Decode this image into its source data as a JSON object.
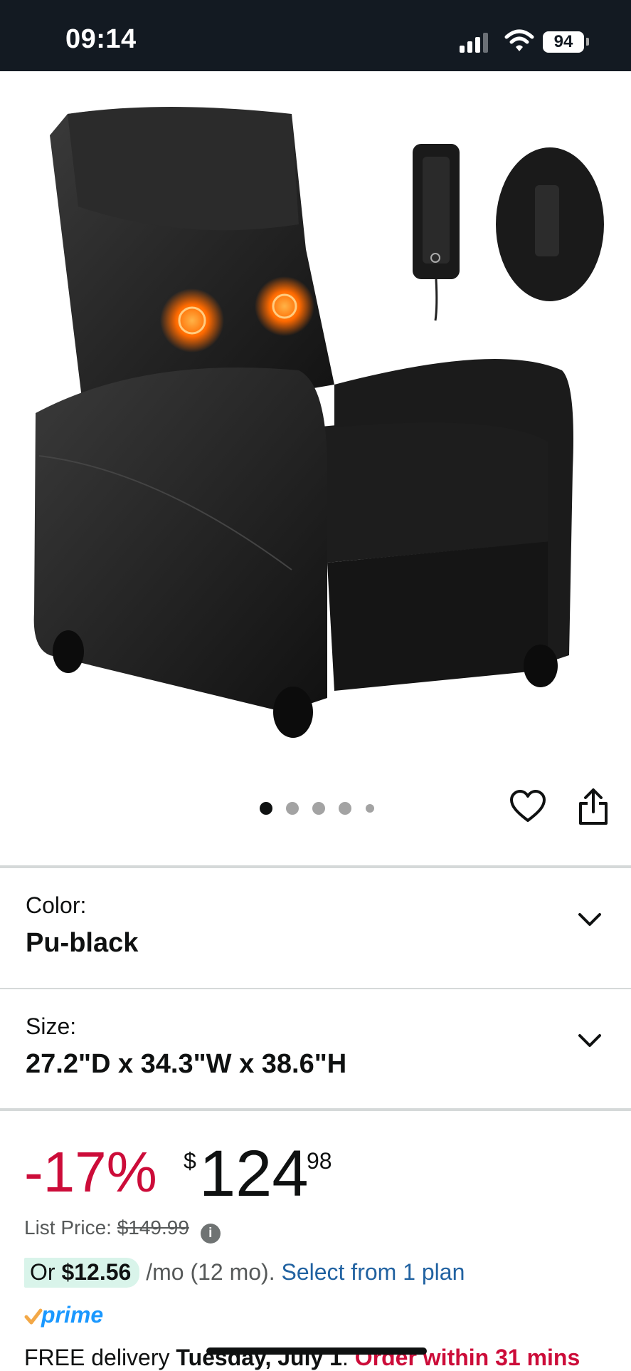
{
  "status_bar": {
    "time": "09:14",
    "battery": "94"
  },
  "gallery": {
    "dot_count": 5,
    "active_index": 0
  },
  "color_selector": {
    "label": "Color:",
    "value": "Pu-black"
  },
  "size_selector": {
    "label": "Size:",
    "value": "27.2\"D x 34.3\"W x 38.6\"H"
  },
  "price": {
    "discount": "-17%",
    "currency": "$",
    "whole": "124",
    "fraction": "98",
    "list_price_label": "List Price:",
    "list_price": "$149.99"
  },
  "installment": {
    "prefix": "Or",
    "amount": "$12.56",
    "terms": "/mo (12 mo).",
    "link": "Select from 1 plan"
  },
  "prime": {
    "label": "prime"
  },
  "delivery": {
    "prefix": "FREE delivery",
    "date": "Tuesday, July 1",
    "separator": ".",
    "urgency": "Order within 31 mins"
  },
  "colors": {
    "accent_red": "#cc0c39",
    "link_blue": "#2162a1",
    "prime_blue": "#1a98ff",
    "prime_orange": "#f3a847"
  }
}
